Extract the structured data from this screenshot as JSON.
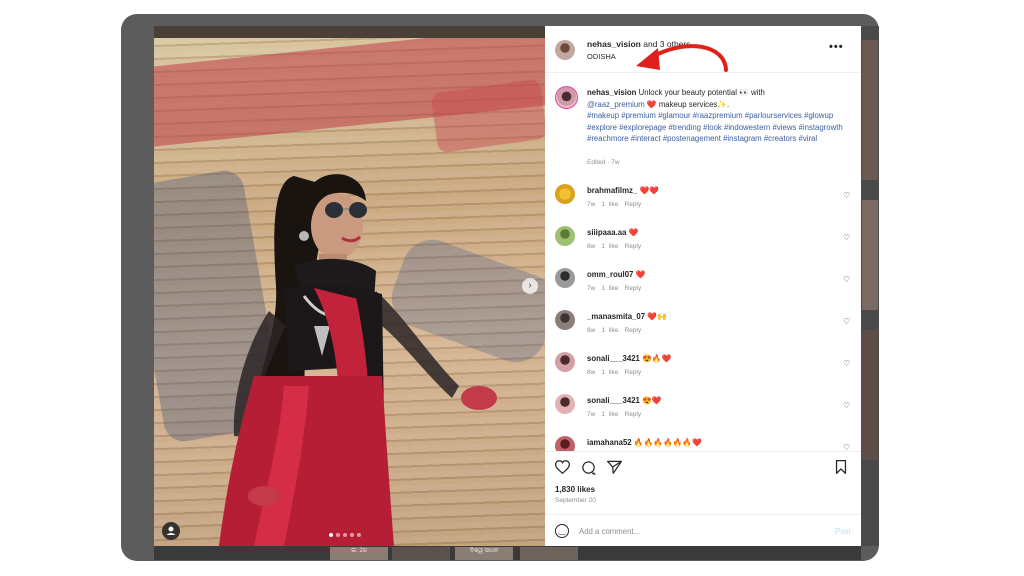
{
  "post": {
    "header": {
      "username": "nehas_vision",
      "coauthors_text": "and 3 others",
      "location": "ODISHA",
      "more_icon": "more-horizontal-icon"
    },
    "caption": {
      "username": "nehas_vision",
      "text_part1": "Unlock your beauty potential 👀 with",
      "mention": "@raaz_premium",
      "heart": "❤️",
      "text_part2": "makeup services✨.",
      "hashtags": "#makeup #premium #glamour #raazpremium #parlourservices #glowup #explore #explorepage #trending #look #indowestern #views #instagrowth #reachmore #interact #postenagement #instagram #creators #viral",
      "edited": "Edited · 7w"
    },
    "comments": [
      {
        "username": "brahmafilmz_",
        "text": "❤️❤️",
        "age": "7w",
        "likes": "1 like",
        "reply": "Reply"
      },
      {
        "username": "siiipaaa.aa",
        "text": "❤️",
        "age": "8w",
        "likes": "1 like",
        "reply": "Reply"
      },
      {
        "username": "omm_roul07",
        "text": "❤️",
        "age": "7w",
        "likes": "1 like",
        "reply": "Reply"
      },
      {
        "username": "_manasmita_07",
        "text": "❤️🙌",
        "age": "8w",
        "likes": "1 like",
        "reply": "Reply"
      },
      {
        "username": "sonali___3421",
        "text": "😍🔥❤️",
        "age": "8w",
        "likes": "1 like",
        "reply": "Reply"
      },
      {
        "username": "sonali___3421",
        "text": "😍❤️",
        "age": "7w",
        "likes": "1 like",
        "reply": "Reply"
      },
      {
        "username": "iamahana52",
        "text": "🔥🔥🔥🔥🔥🔥❤️",
        "age": "",
        "likes": "",
        "reply": ""
      }
    ],
    "likes": "1,830 likes",
    "date": "September 20",
    "comment_box": {
      "placeholder": "Add a comment...",
      "post_label": "Post"
    },
    "icons": {
      "like": "heart-icon",
      "comment": "comment-icon",
      "share": "send-icon",
      "save": "bookmark-icon",
      "emoji": "emoji-icon"
    }
  },
  "background_thumbs": [
    "ଇ. 2ଜ",
    "",
    "ବିଶ୍ୱ ସାଧନ",
    ""
  ],
  "colors": {
    "link": "#3c5e9e",
    "heart": "#e0245e",
    "annotation_arrow": "#e0201b",
    "post_button": "#b2dffc"
  }
}
